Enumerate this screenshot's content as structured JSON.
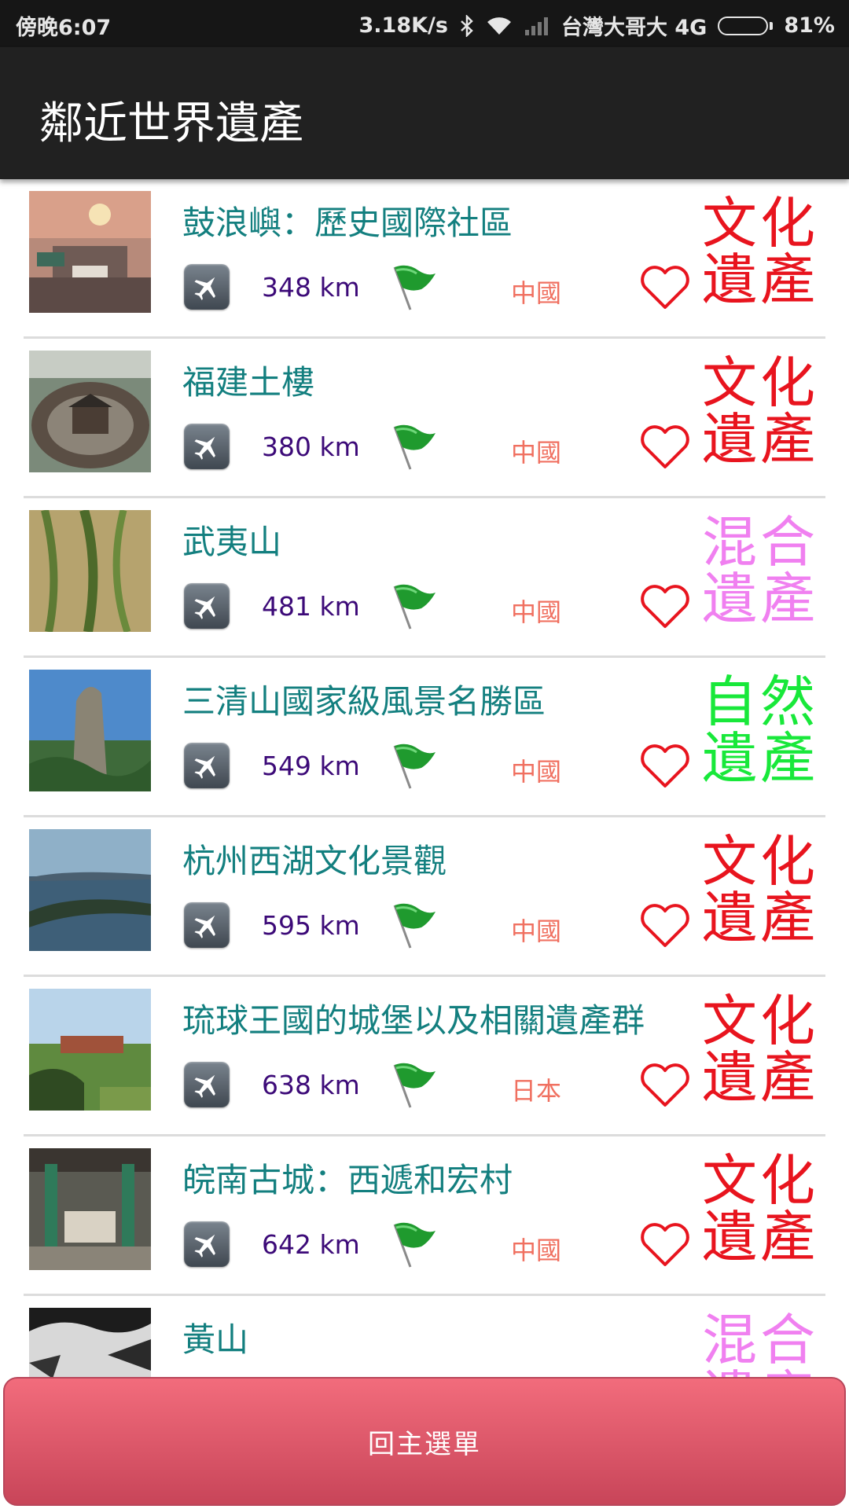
{
  "status_bar": {
    "time": "傍晚6:07",
    "speed": "3.18K/s",
    "carrier": "台灣大哥大 4G",
    "battery": "81%",
    "battery_level": 0.81
  },
  "app_bar": {
    "title": "鄰近世界遺產"
  },
  "items": [
    {
      "name": "鼓浪嶼：歷史國際社區",
      "distance": "348 km",
      "country": "中國",
      "heritage": "文化\n遺產",
      "heritage_color": "#e8141e"
    },
    {
      "name": "福建土樓",
      "distance": "380 km",
      "country": "中國",
      "heritage": "文化\n遺產",
      "heritage_color": "#e8141e"
    },
    {
      "name": "武夷山",
      "distance": "481 km",
      "country": "中國",
      "heritage": "混合\n遺產",
      "heritage_color": "#f080f0"
    },
    {
      "name": "三清山國家級風景名勝區",
      "distance": "549 km",
      "country": "中國",
      "heritage": "自然\n遺產",
      "heritage_color": "#18e83a"
    },
    {
      "name": "杭州西湖文化景觀",
      "distance": "595 km",
      "country": "中國",
      "heritage": "文化\n遺產",
      "heritage_color": "#e8141e"
    },
    {
      "name": "琉球王國的城堡以及相關遺產群",
      "distance": "638 km",
      "country": "日本",
      "heritage": "文化\n遺產",
      "heritage_color": "#e8141e"
    },
    {
      "name": "皖南古城：西遞和宏村",
      "distance": "642 km",
      "country": "中國",
      "heritage": "文化\n遺產",
      "heritage_color": "#e8141e"
    },
    {
      "name": "黃山",
      "distance": "",
      "country": "",
      "heritage": "混合\n遺產",
      "heritage_color": "#f080f0"
    }
  ],
  "icons": {
    "plane": "airplane-icon",
    "flag": "green-flag-icon",
    "favorite": "heart-outline-icon",
    "favorite_color": "#e8141e"
  },
  "footer": {
    "main_menu_label": "回主選單"
  }
}
